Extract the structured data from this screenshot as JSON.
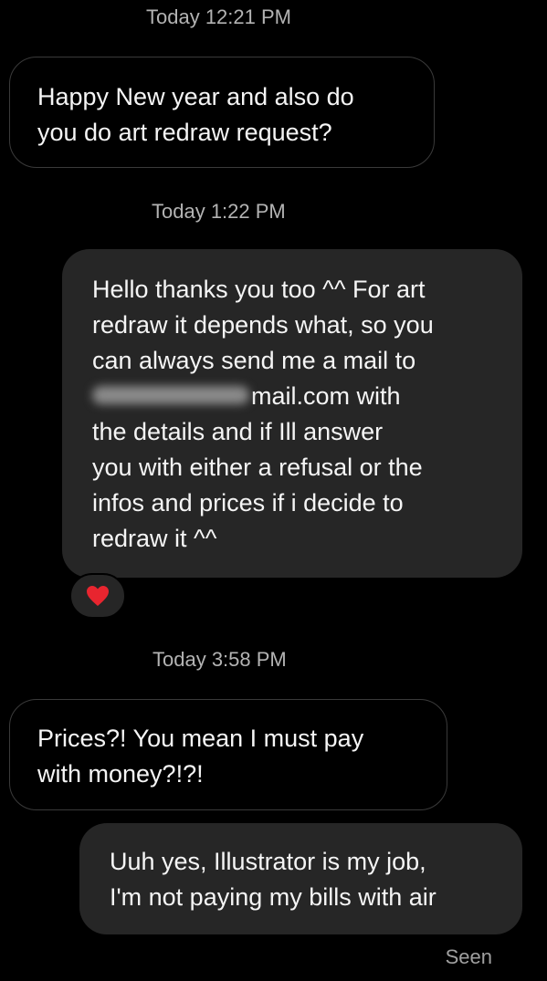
{
  "thread": {
    "messages": [
      {
        "timestamp": "Today 12:21 PM",
        "direction": "incoming",
        "lines": [
          "Happy New year and also do",
          "you do art redraw request?"
        ]
      },
      {
        "timestamp": "Today 1:22 PM",
        "direction": "outgoing",
        "lines": [
          "Hello thanks you too ^^ For art",
          "redraw it depends what, so you",
          "can always send me a mail to",
          "mail.com with",
          "the details and if Ill answer",
          "you with either a refusal or the",
          "infos and prices if i decide to",
          "redraw it ^^"
        ],
        "reaction": "heart-icon"
      },
      {
        "timestamp": "Today 3:58 PM",
        "direction": "incoming",
        "lines": [
          "Prices?! You mean I must pay",
          "with money?!?!"
        ]
      },
      {
        "direction": "outgoing",
        "lines": [
          "Uuh yes, Illustrator is my job,",
          "I'm not paying my bills with air"
        ]
      }
    ],
    "seen_label": "Seen"
  },
  "colors": {
    "background": "#000000",
    "outgoing_bubble": "#262626",
    "incoming_border": "#3a3a3a",
    "timestamp_text": "#b3b3b3",
    "reaction_heart": "#e8252f"
  }
}
